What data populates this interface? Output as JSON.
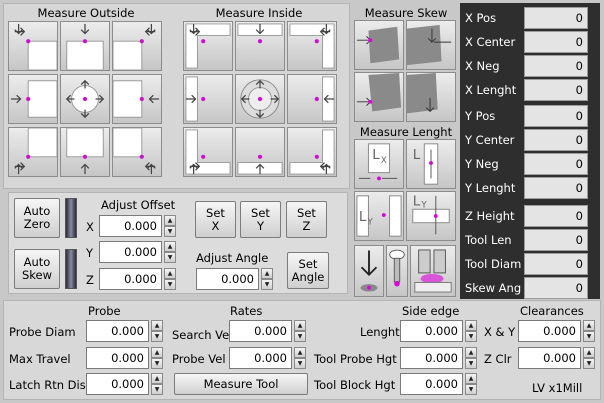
{
  "titles": {
    "measure_outside": "Measure Outside",
    "measure_inside": "Measure Inside",
    "measure_skew": "Measure Skew",
    "measure_length": "Measure Lenght",
    "adjust_offset": "Adjust Offset",
    "adjust_angle": "Adjust Angle",
    "probe": "Probe",
    "rates": "Rates",
    "side_edge": "Side edge",
    "clearances": "Clearances"
  },
  "outside_grid": [
    "X-Y- corner",
    "Y- edge",
    "X+Y- corner",
    "X- edge",
    "center",
    "X+ edge",
    "X-Y+ corner",
    "Y+ edge",
    "X+Y+ corner"
  ],
  "readouts": [
    {
      "label": "X Pos",
      "value": "0"
    },
    {
      "label": "X Center",
      "value": "0"
    },
    {
      "label": "X Neg",
      "value": "0"
    },
    {
      "label": "X Lenght",
      "value": "0"
    },
    {
      "label": "Y Pos",
      "value": "0"
    },
    {
      "label": "Y Center",
      "value": "0"
    },
    {
      "label": "Y Neg",
      "value": "0"
    },
    {
      "label": "Y Lenght",
      "value": "0"
    },
    {
      "label": "Z Height",
      "value": "0"
    },
    {
      "label": "Tool Len",
      "value": "0"
    },
    {
      "label": "Tool Diam",
      "value": "0"
    },
    {
      "label": "Skew Ang",
      "value": "0"
    }
  ],
  "buttons": {
    "auto_zero": [
      "Auto",
      "Zero"
    ],
    "auto_skew": [
      "Auto",
      "Skew"
    ],
    "set_x": [
      "Set",
      "X"
    ],
    "set_y": [
      "Set",
      "Y"
    ],
    "set_z": [
      "Set",
      "Z"
    ],
    "set_angle": [
      "Set",
      "Angle"
    ],
    "measure_tool": "Measure Tool"
  },
  "offset": {
    "x_label": "X",
    "x_value": "0.000",
    "y_label": "Y",
    "y_value": "0.000",
    "z_label": "Z",
    "z_value": "0.000",
    "angle_value": "0.000"
  },
  "probe": {
    "diam_label": "Probe Diam",
    "diam_value": "0.000",
    "travel_label": "Max Travel",
    "travel_value": "0.000",
    "latch_label": "Latch Rtn Dist",
    "latch_value": "0.000"
  },
  "rates": {
    "search_label": "Search Vel",
    "search_value": "0.000",
    "probe_label": "Probe Vel",
    "probe_value": "0.000"
  },
  "side_edge": {
    "length_label": "Lenght",
    "length_value": "0.000",
    "probe_hgt_label": "Tool Probe Hgt",
    "probe_hgt_value": "0.000",
    "block_hgt_label": "Tool Block Hgt",
    "block_hgt_value": "0.000"
  },
  "clearances": {
    "xy_label": "X & Y",
    "xy_value": "0.000",
    "zclr_label": "Z Clr",
    "zclr_value": "0.000"
  },
  "footer": "LV x1Mill",
  "spinner_up": "▲",
  "spinner_down": "▼"
}
